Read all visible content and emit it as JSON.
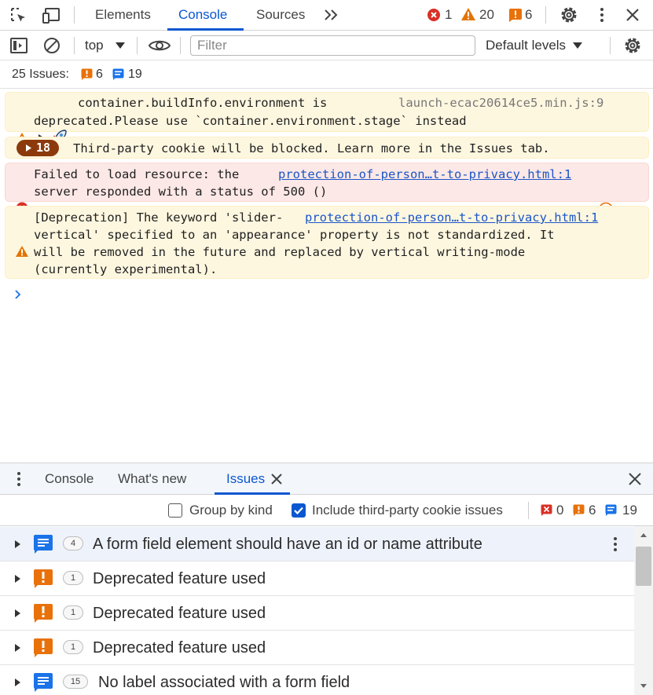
{
  "tabs": {
    "elements": "Elements",
    "console": "Console",
    "sources": "Sources"
  },
  "counts": {
    "errors": "1",
    "warnings": "20",
    "issues": "6"
  },
  "toolbar": {
    "context": "top",
    "filter_placeholder": "Filter",
    "levels": "Default levels"
  },
  "issues_summary": {
    "label": "25 Issues:",
    "breaking": "6",
    "info": "19"
  },
  "messages": [
    {
      "level": "warning",
      "line1": "container.buildInfo.environment is",
      "line2": "deprecated.Please use `container.environment.stage` instead",
      "source": "launch-ecac20614ce5.min.js:9"
    },
    {
      "level": "group",
      "count": "18",
      "text": "Third-party cookie will be blocked. Learn more in the Issues tab."
    },
    {
      "level": "error",
      "line1": "Failed to load resource: the",
      "line2": "server responded with a status of 500 ()",
      "source": "protection-of-person…t-to-privacy.html:1"
    },
    {
      "level": "warning",
      "line1": "[Deprecation] The keyword 'slider-",
      "line2": "vertical' specified to an 'appearance' property is not standardized. It",
      "line3": "will be removed in the future and replaced by vertical writing-mode",
      "line4": "(currently experimental).",
      "source": "protection-of-person…t-to-privacy.html:1"
    }
  ],
  "drawer": {
    "console": "Console",
    "whats_new": "What's new",
    "issues": "Issues"
  },
  "issues_toolbar": {
    "group_by_kind": "Group by kind",
    "include_third_party": "Include third-party cookie issues",
    "errors": "0",
    "breaking": "6",
    "info": "19"
  },
  "issues": [
    {
      "kind": "info",
      "count": "4",
      "title": "A form field element should have an id or name attribute"
    },
    {
      "kind": "breaking",
      "count": "1",
      "title": "Deprecated feature used"
    },
    {
      "kind": "breaking",
      "count": "1",
      "title": "Deprecated feature used"
    },
    {
      "kind": "breaking",
      "count": "1",
      "title": "Deprecated feature used"
    },
    {
      "kind": "info",
      "count": "15",
      "title": "No label associated with a form field"
    }
  ],
  "colors": {
    "accent": "#0b57d0",
    "error": "#d93025",
    "warning": "#e37400",
    "issue_breaking": "#e8710a",
    "issue_info": "#1a73e8"
  }
}
